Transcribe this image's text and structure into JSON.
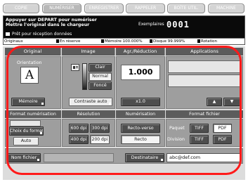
{
  "top_tabs": [
    {
      "label": "COPIE"
    },
    {
      "label": "NUMÉRISER"
    },
    {
      "label": "ENREGISTRER"
    },
    {
      "label": "RAPPELER"
    },
    {
      "label": "BOÎTE UTIL."
    },
    {
      "label": "MACHINE"
    }
  ],
  "message": {
    "line1": "Appuyer sur DEPART pour numériser",
    "line2": "Mettre l'original dans le chargeur",
    "line3": "Prêt pour réception données",
    "copies_label": "Exemplaires",
    "copies_count": "0001"
  },
  "status": {
    "originals": "Originaux",
    "reserve": "En réserve",
    "memory": "Mémoire 100.000%",
    "disk": "Disque 99.999%",
    "rotation": "Rotation"
  },
  "tabs": {
    "original": "Original",
    "image": "Image",
    "zoom": "Agr./Réduction",
    "applications": "Applications"
  },
  "original": {
    "label": "Orientation",
    "icon_letter": "A",
    "memory_button": "Mémoire"
  },
  "image": {
    "light": "Clair",
    "normal": "Normal",
    "dark": "Foncé",
    "auto_contrast": "Contraste auto"
  },
  "zoom": {
    "value": "1.000",
    "x1_button": "x1.0"
  },
  "applications": {
    "up_arrow": "▲",
    "down_arrow": "▼"
  },
  "sections": {
    "scan_format": "Format numérisation",
    "resolution": "Résolution",
    "scanning": "Numérisation",
    "file_format": "Format fichier"
  },
  "scan_format": {
    "choose": "Choix du format",
    "auto": "Auto"
  },
  "resolution": {
    "r600": "600 dpi",
    "r300": "300 dpi",
    "r400": "400 dpi",
    "r200": "200 dpi"
  },
  "scanning": {
    "duplex": "Recto-verso",
    "simplex": "Recto"
  },
  "file_format": {
    "batch_label": "Paquet",
    "division_label": "Division",
    "tiff": "TIFF",
    "pdf": "PDF"
  },
  "bottom": {
    "filename_button": "Nom fichier",
    "recipient_button": "Destinataire",
    "recipient_value": "abc@def.com"
  }
}
